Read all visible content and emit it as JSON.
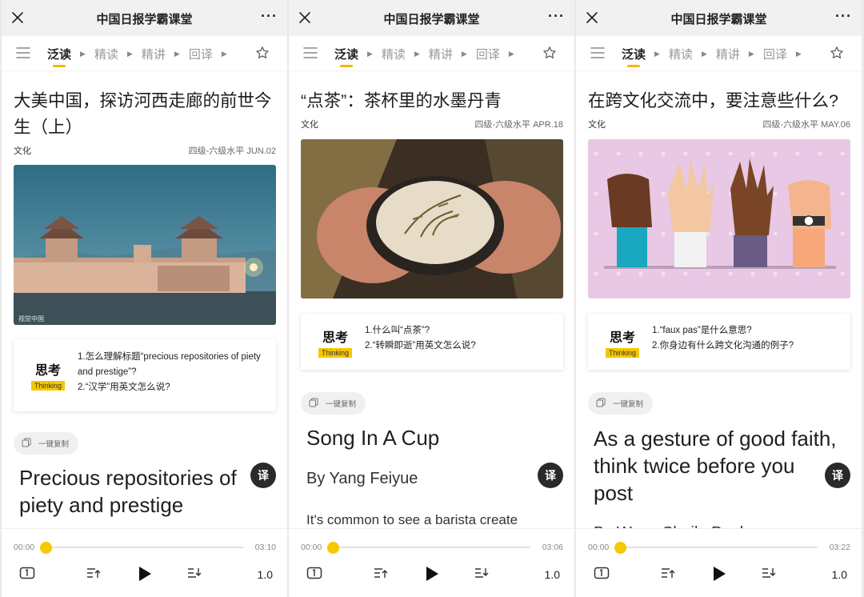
{
  "app": {
    "title": "中国日报学霸课堂",
    "more": "···",
    "tabs": [
      "泛读",
      "精读",
      "精讲",
      "回译"
    ]
  },
  "panels": [
    {
      "headline": "大美中国，探访河西走廊的前世今生（上）",
      "category": "文化",
      "level_date": "四级-六级水平 JUN.02",
      "photo_credit": "视觉中国",
      "think_zh": "思考",
      "think_en": "Thinking",
      "questions": [
        "1.怎么理解标题“precious repositories of piety and prestige”?",
        "2.“汉学”用英文怎么说?"
      ],
      "copy_label": "一键复制",
      "article_title": "Precious repositories of piety and prestige",
      "byline": "",
      "body": "",
      "translate_label": "译",
      "time_start": "00:00",
      "time_end": "03:10",
      "speed": "1.0"
    },
    {
      "headline": "“点茶”：茶杯里的水墨丹青",
      "category": "文化",
      "level_date": "四级-六级水平 APR.18",
      "photo_credit": "",
      "think_zh": "思考",
      "think_en": "Thinking",
      "questions": [
        "1.什么叫“点茶”?",
        "2.“转瞬即逝”用英文怎么说?"
      ],
      "copy_label": "一键复制",
      "article_title": "Song In A Cup",
      "byline": "By Yang Feiyue",
      "body": "It's common to see a barista create",
      "translate_label": "译",
      "time_start": "00:00",
      "time_end": "03:06",
      "speed": "1.0"
    },
    {
      "headline": "在跨文化交流中，要注意些什么?",
      "category": "文化",
      "level_date": "四级-六级水平 MAY.06",
      "photo_credit": "",
      "think_zh": "思考",
      "think_en": "Thinking",
      "questions": [
        "1.“faux pas”是什么意思?",
        "2.你身边有什么跨文化沟通的例子?"
      ],
      "copy_label": "一键复制",
      "article_title": "As a gesture of good faith, think twice before you post",
      "byline": "By Wang Sheila Paula",
      "body": "",
      "translate_label": "译",
      "time_start": "00:00",
      "time_end": "03:22",
      "speed": "1.0"
    }
  ],
  "colors": {
    "accent": "#f6c800",
    "think_tag": "#f7c600",
    "text": "#1c1c1c",
    "muted": "#999999"
  },
  "icons": [
    "close-icon",
    "more-icon",
    "menu-icon",
    "star-icon",
    "copy-icon",
    "playlist-back-icon",
    "play-icon",
    "playlist-forward-icon",
    "subtitle-icon"
  ]
}
